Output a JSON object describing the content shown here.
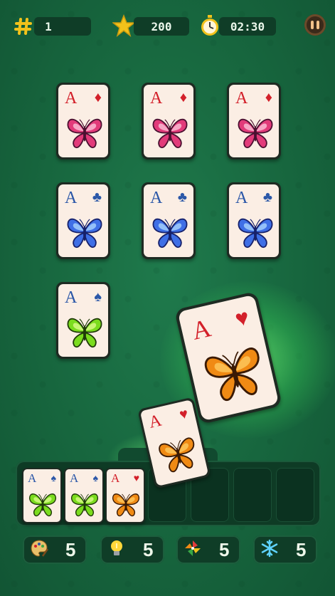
{
  "hud": {
    "level_icon": "hash-icon",
    "level": "1",
    "score_icon": "star-icon",
    "score": "200",
    "timer_icon": "stopwatch-icon",
    "timer": "02:30",
    "pause_icon": "pause-icon"
  },
  "colors": {
    "felt": "#17663e",
    "card_face": "#fbeee4",
    "hud_yellow": "#f2c21b",
    "glow": "#7cff7c"
  },
  "board_cards": [
    {
      "rank": "A",
      "suit": "♦",
      "suit_color": "red",
      "butterfly": "pink"
    },
    {
      "rank": "A",
      "suit": "♦",
      "suit_color": "red",
      "butterfly": "pink"
    },
    {
      "rank": "A",
      "suit": "♦",
      "suit_color": "red",
      "butterfly": "pink"
    },
    {
      "rank": "A",
      "suit": "♣",
      "suit_color": "blue",
      "butterfly": "blue"
    },
    {
      "rank": "A",
      "suit": "♣",
      "suit_color": "blue",
      "butterfly": "blue"
    },
    {
      "rank": "A",
      "suit": "♣",
      "suit_color": "blue",
      "butterfly": "blue"
    },
    {
      "rank": "A",
      "suit": "♠",
      "suit_color": "blue",
      "butterfly": "green"
    }
  ],
  "moving_cards": [
    {
      "rank": "A",
      "suit": "♥",
      "suit_color": "red",
      "butterfly": "orange"
    },
    {
      "rank": "A",
      "suit": "♥",
      "suit_color": "red",
      "butterfly": "orange"
    }
  ],
  "tray_cards": [
    {
      "rank": "A",
      "suit": "♠",
      "suit_color": "blue",
      "butterfly": "green"
    },
    {
      "rank": "A",
      "suit": "♠",
      "suit_color": "blue",
      "butterfly": "green"
    },
    {
      "rank": "A",
      "suit": "♥",
      "suit_color": "red",
      "butterfly": "orange"
    }
  ],
  "tray_empty_slots": 4,
  "powerups": [
    {
      "icon": "palette-icon",
      "count": "5"
    },
    {
      "icon": "lightbulb-icon",
      "count": "5"
    },
    {
      "icon": "pinwheel-icon",
      "count": "5"
    },
    {
      "icon": "snowflake-icon",
      "count": "5"
    }
  ]
}
